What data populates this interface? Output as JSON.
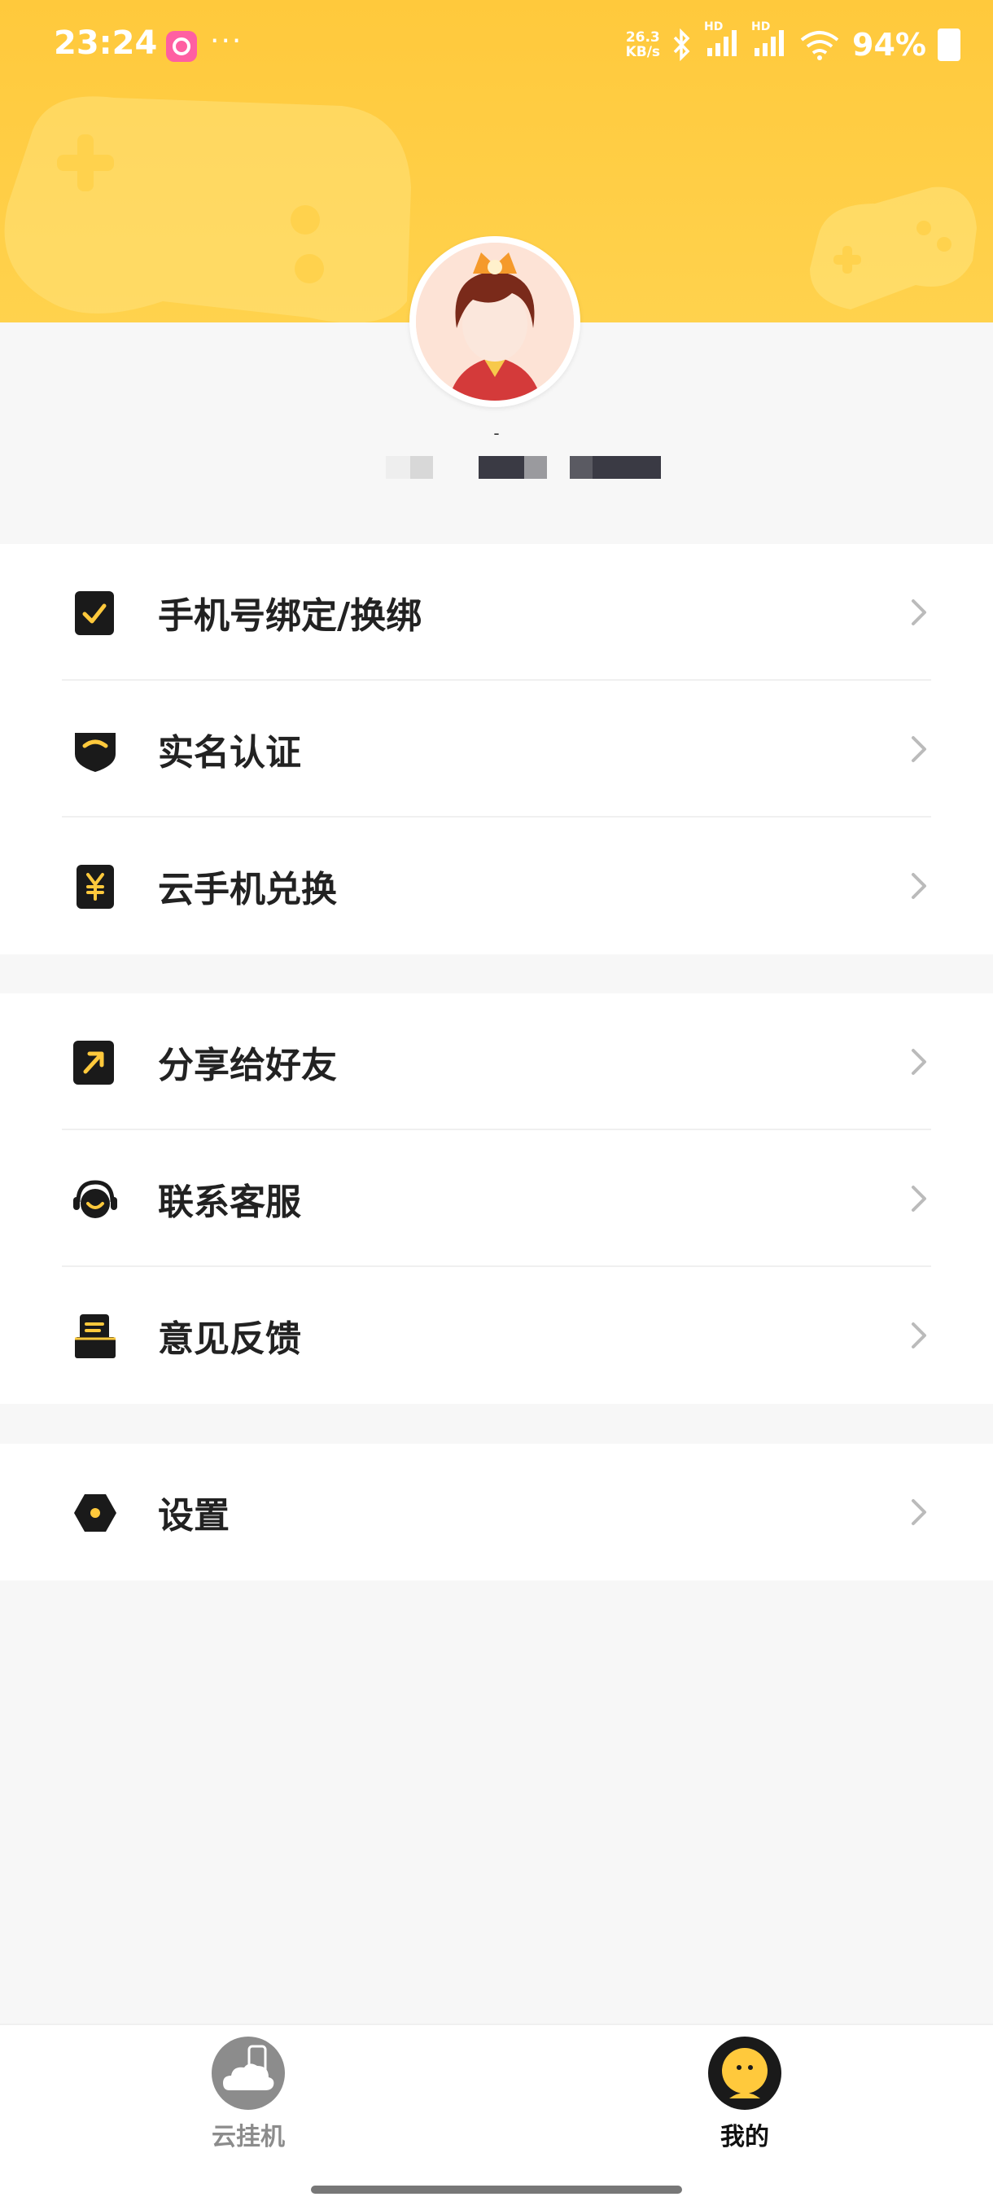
{
  "status_bar": {
    "time": "23:24",
    "dots": "···",
    "net_speed_top": "26.3",
    "net_speed_bottom": "KB/s",
    "hd1": "HD",
    "hd2": "HD",
    "battery_percent": "94%"
  },
  "profile": {
    "name_mark": "-"
  },
  "menu_group_1": [
    {
      "label": "手机号绑定/换绑",
      "icon": "phone-check-icon"
    },
    {
      "label": "实名认证",
      "icon": "shield-icon"
    },
    {
      "label": "云手机兑换",
      "icon": "yen-card-icon"
    }
  ],
  "menu_group_2": [
    {
      "label": "分享给好友",
      "icon": "share-arrow-icon"
    },
    {
      "label": "联系客服",
      "icon": "headset-icon"
    },
    {
      "label": "意见反馈",
      "icon": "feedback-icon"
    }
  ],
  "menu_group_3": [
    {
      "label": "设置",
      "icon": "settings-hex-icon"
    }
  ],
  "tabs": [
    {
      "label": "云挂机",
      "active": false
    },
    {
      "label": "我的",
      "active": true
    }
  ],
  "colors": {
    "accent": "#FFC93C",
    "icon_dark": "#1a1a1a",
    "icon_accent": "#FFC93C"
  }
}
